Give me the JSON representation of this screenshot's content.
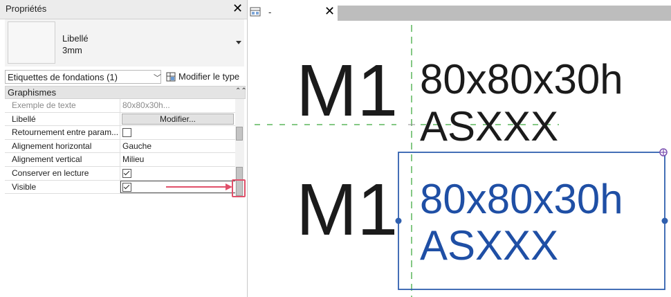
{
  "properties": {
    "title": "Propriétés",
    "type_selector": {
      "name": "Libellé",
      "size": "3mm"
    },
    "instance_filter": "Etiquettes de fondations (1)",
    "edit_type_label": "Modifier le type",
    "group": "Graphismes",
    "rows": [
      {
        "name": "Exemple de texte",
        "value": "80x80x30h..."
      },
      {
        "name": "Libellé",
        "button": "Modifier..."
      },
      {
        "name": "Retournement entre param...",
        "checked": false
      },
      {
        "name": "Alignement horizontal",
        "value": "Gauche"
      },
      {
        "name": "Alignement vertical",
        "value": "Milieu"
      },
      {
        "name": "Conserver en lecture",
        "checked": true
      },
      {
        "name": "Visible",
        "checked": true
      }
    ]
  },
  "view": {
    "tab_label": "-",
    "tags": [
      {
        "mark": "M1",
        "line1": "80x80x30h",
        "line2": "ASXXX",
        "selected": false
      },
      {
        "mark": "M1",
        "line1": "80x80x30h",
        "line2": "ASXXX",
        "selected": true
      }
    ]
  },
  "colors": {
    "selection_blue": "#2f5fae",
    "selected_text": "#1f4fa5",
    "guide_green": "#5bb55b",
    "callout_red": "#e0506a"
  }
}
